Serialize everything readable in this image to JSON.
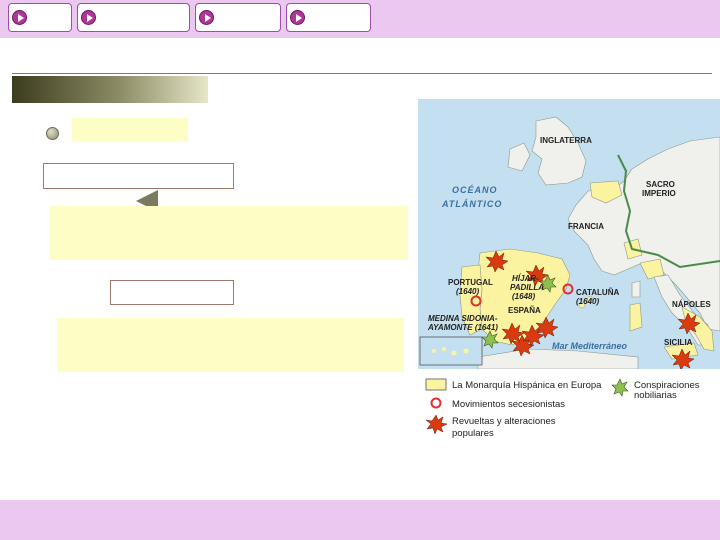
{
  "nav": {
    "buttons": [
      "",
      "",
      "",
      ""
    ]
  },
  "map": {
    "labels": {
      "inglaterra": "INGLATERRA",
      "oceano_1": "OCÉANO",
      "oceano_2": "ATLÁNTICO",
      "sacro_1": "SACRO",
      "sacro_2": "IMPERIO",
      "francia": "FRANCIA",
      "portugal": "PORTUGAL",
      "portugal_year": "(1640)",
      "hijar_1": "HÍJAR-",
      "hijar_2": "PADILLA",
      "hijar_year": "(1648)",
      "cataluna": "CATALUÑA",
      "cataluna_year": "(1640)",
      "espana": "ESPAÑA",
      "medina_1": "MEDINA SIDONIA-",
      "medina_2": "AYAMONTE (1641)",
      "mediterraneo": "Mar Mediterráneo",
      "napoles": "NÁPOLES",
      "sicilia": "SICILIA"
    },
    "legend": {
      "monarquia": "La Monarquía Hispánica en Europa",
      "secesionistas": "Movimientos secesionistas",
      "revueltas_1": "Revueltas y alteraciones",
      "revueltas_2": "populares",
      "conspiraciones_1": "Conspiraciones",
      "conspiraciones_2": "nobiliarias"
    },
    "colors": {
      "sea": "#c4e0f0",
      "land": "#f0f0ec",
      "monarquia": "#fbf3a0",
      "border_empire": "#4a8a4a",
      "secession_ring": "#e03030"
    }
  },
  "colors": {
    "topbar": "#ebc8f0",
    "bottombar": "#ebc8f0",
    "yellow_box": "#fdfdc6"
  }
}
